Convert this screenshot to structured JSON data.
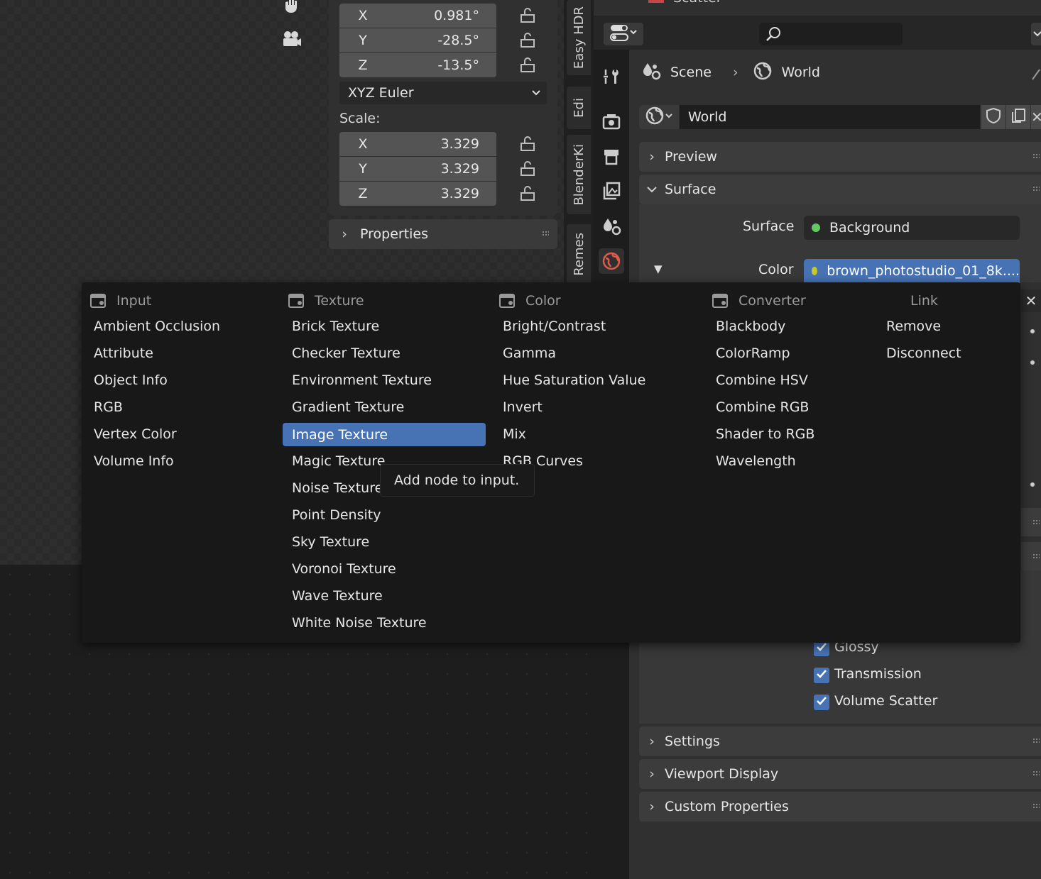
{
  "viewport": {
    "icons": [
      "hand-icon",
      "camera-icon"
    ]
  },
  "transform": {
    "rotation": [
      {
        "axis": "X",
        "value": "0.981°"
      },
      {
        "axis": "Y",
        "value": "-28.5°"
      },
      {
        "axis": "Z",
        "value": "-13.5°"
      }
    ],
    "rotation_mode": "XYZ Euler",
    "scale_label": "Scale:",
    "scale": [
      {
        "axis": "X",
        "value": "3.329"
      },
      {
        "axis": "Y",
        "value": "3.329"
      },
      {
        "axis": "Z",
        "value": "3.329"
      }
    ],
    "properties_label": "Properties"
  },
  "vertical_tabs": [
    "Easy HDR",
    "Edi",
    "BlenderKi",
    "Remes"
  ],
  "properties_editor": {
    "header_top_label": "Scatter",
    "breadcrumb": {
      "scene": "Scene",
      "world": "World"
    },
    "world_selector": "World",
    "panels": {
      "preview": "Preview",
      "surface": "Surface",
      "settings": "Settings",
      "viewport_display": "Viewport Display",
      "custom_properties": "Custom Properties"
    },
    "surface_field_label": "Surface",
    "surface_value": "Background",
    "color_field_label": "Color",
    "color_value": "brown_photostudio_01_8k....",
    "ray_visibility": [
      "Glossy",
      "Transmission",
      "Volume Scatter"
    ]
  },
  "menu": {
    "columns": [
      {
        "header": "Input",
        "items": [
          "Ambient Occlusion",
          "Attribute",
          "Object Info",
          "RGB",
          "Vertex Color",
          "Volume Info"
        ]
      },
      {
        "header": "Texture",
        "items": [
          "Brick Texture",
          "Checker Texture",
          "Environment Texture",
          "Gradient Texture",
          "Image Texture",
          "Magic Texture",
          "Noise Texture",
          "Point Density",
          "Sky Texture",
          "Voronoi Texture",
          "Wave Texture",
          "White Noise Texture"
        ]
      },
      {
        "header": "Color",
        "items": [
          "Bright/Contrast",
          "Gamma",
          "Hue Saturation Value",
          "Invert",
          "Mix",
          "RGB Curves"
        ]
      },
      {
        "header": "Converter",
        "items": [
          "Blackbody",
          "ColorRamp",
          "Combine HSV",
          "Combine RGB",
          "Shader to RGB",
          "Wavelength"
        ]
      },
      {
        "header": "Link",
        "items": [
          "Remove",
          "Disconnect"
        ]
      }
    ],
    "highlighted": "Image Texture",
    "tooltip": "Add node to input."
  },
  "colors": {
    "accent": "#4772b3",
    "surface_socket": "#63c763",
    "color_socket": "#c7c729",
    "world_icon": "#e05a4a"
  }
}
